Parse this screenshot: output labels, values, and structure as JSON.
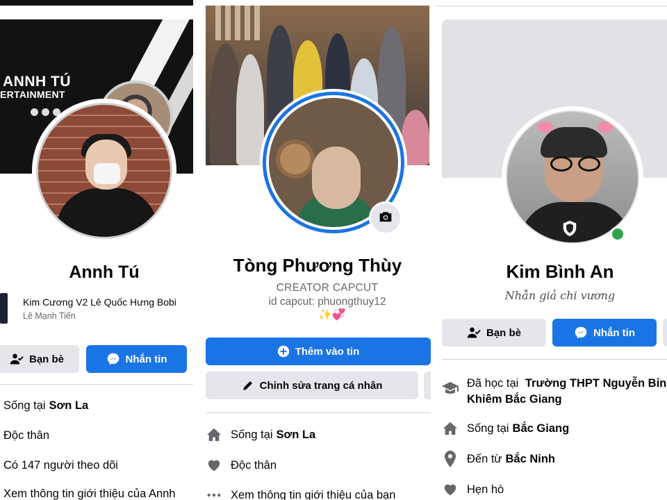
{
  "colors": {
    "accent": "#1b74e4",
    "button_gray": "#e4e6eb",
    "secondary_text": "#65676b",
    "online": "#31a24c"
  },
  "profile1": {
    "cover_title": "ANNH TÚ",
    "cover_subtitle": "ERTAINMENT",
    "name": "Annh Tú",
    "music": {
      "song": "Kim Cương V2 Lê Quốc Hưng Bobi",
      "artist": "Lê Mạnh Tiến"
    },
    "buttons": {
      "friends": "Bạn bè",
      "message": "Nhắn tin"
    },
    "intro": {
      "lives_prefix": "Sống tại",
      "lives_place": "Sơn La",
      "relationship": "Độc thân",
      "followers": "Có 147 người theo dõi",
      "see_more": "Xem thông tin giới thiệu của Annh"
    },
    "icons": {
      "friends": "user-check-icon",
      "message": "messenger-icon"
    }
  },
  "profile2": {
    "name": "Tòng Phương Thùy",
    "bio_line1": "CREATOR CAPCUT",
    "bio_line2": "id capcut: phuongthuy12",
    "bio_line3": "✨💞",
    "buttons": {
      "add_story": "Thêm vào tin",
      "edit_profile": "Chỉnh sửa trang cá nhân"
    },
    "intro": {
      "lives_prefix": "Sống tại",
      "lives_place": "Sơn La",
      "relationship": "Độc thân",
      "see_more": "Xem thông tin giới thiệu của bạn"
    },
    "icons": {
      "camera": "camera-icon",
      "add": "plus-circle-icon",
      "edit": "pencil-icon",
      "home": "home-icon",
      "heart": "heart-icon",
      "more": "ellipsis-icon"
    }
  },
  "profile3": {
    "name": "Kim Bình An",
    "bio": "Nhẫn giả chi vương",
    "buttons": {
      "friends": "Bạn bè",
      "message": "Nhắn tin"
    },
    "intro": {
      "studied_prefix": "Đã học tại",
      "studied_place_line1": "Trường THPT Nguyễn Bỉnh",
      "studied_place_line2": "Khiêm Bắc Giang",
      "lives_prefix": "Sống tại",
      "lives_place": "Bắc Giang",
      "from_prefix": "Đến từ",
      "from_place": "Bắc Ninh",
      "dating": "Hẹn hò"
    },
    "icons": {
      "school": "graduation-cap-icon",
      "home": "home-icon",
      "location": "map-pin-icon",
      "heart": "heart-icon",
      "shield": "shield-icon"
    }
  }
}
